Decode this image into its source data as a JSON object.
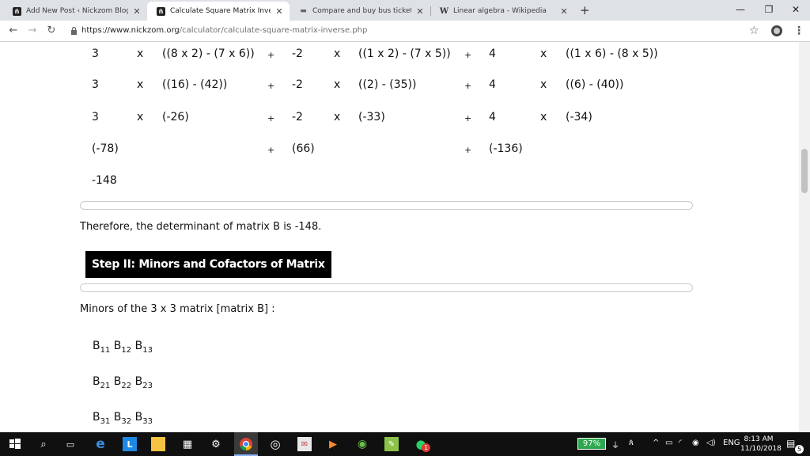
{
  "tabs": [
    {
      "title": "Add New Post ‹ Nickzom Blog —",
      "favicon": "nickzom-logo-icon"
    },
    {
      "title": "Calculate Square Matrix Inverse",
      "favicon": "nickzom-logo-icon"
    },
    {
      "title": "Compare and buy bus tickets onl",
      "favicon": "bus-icon"
    },
    {
      "title": "Linear algebra - Wikipedia",
      "favicon": "wikipedia-icon"
    }
  ],
  "url": {
    "host": "https://www.nickzom.org",
    "path": "/calculator/calculate-square-matrix-inverse.php"
  },
  "calc": {
    "row1": [
      "3",
      "x",
      "((8 x 2) - (7 x 6))",
      "+",
      "-2",
      "x",
      "((1 x 2) - (7 x 5))",
      "+",
      "4",
      "x",
      "((1 x 6) - (8 x 5))"
    ],
    "row2": [
      "3",
      "x",
      "((16) - (42))",
      "+",
      "-2",
      "x",
      "((2) - (35))",
      "+",
      "4",
      "x",
      "((6) - (40))"
    ],
    "row3": [
      "3",
      "x",
      "(-26)",
      "+",
      "-2",
      "x",
      "(-33)",
      "+",
      "4",
      "x",
      "(-34)"
    ],
    "row4": [
      "(-78)",
      "+",
      "(66)",
      "+",
      "(-136)"
    ],
    "row5": "-148"
  },
  "conclusion": "Therefore, the determinant of matrix B is -148.",
  "step_heading": "Step II: Minors and Cofactors of Matrix B",
  "minors_intro": "Minors of the 3 x 3 matrix [matrix B] :",
  "minors": {
    "row1": [
      "B",
      "11",
      "B",
      "12",
      "B",
      "13"
    ],
    "row2": [
      "B",
      "21",
      "B",
      "22",
      "B",
      "23"
    ],
    "row3": [
      "B",
      "31",
      "B",
      "32",
      "B",
      "33"
    ]
  },
  "taskbar": {
    "battery": "97%",
    "lang": "ENG",
    "time": "8:13 AM",
    "date": "11/10/2018",
    "notif_count": "5",
    "badge": "1"
  },
  "colors": {
    "accent": "#000000",
    "battery": "#2ea84f",
    "taskbar": "#101010"
  }
}
